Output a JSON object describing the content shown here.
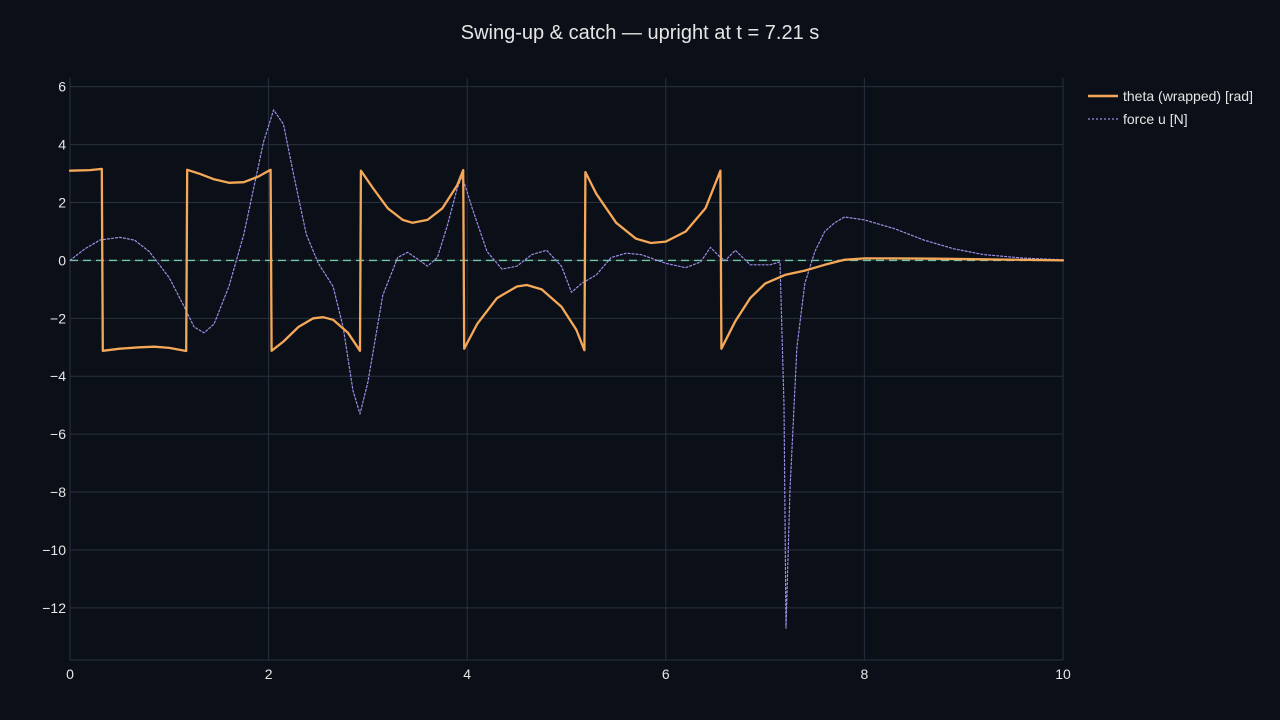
{
  "colors": {
    "background": "#0b0f17",
    "grid": "#283040",
    "text": "#e6e6e6",
    "theta": "#f5a858",
    "force": "#9b8fe6",
    "zero_line": "#6fc7a6"
  },
  "chart_data": {
    "type": "line",
    "title": "Swing-up & catch — upright at t = 7.21 s",
    "xlabel": "",
    "ylabel": "",
    "xlim": [
      0,
      10
    ],
    "ylim": [
      -13.8,
      6.3
    ],
    "x_ticks": [
      0,
      2,
      4,
      6,
      8,
      10
    ],
    "y_ticks": [
      6,
      4,
      2,
      0,
      -2,
      -4,
      -6,
      -8,
      -10,
      -12
    ],
    "grid": true,
    "legend_position": "top-right",
    "reference_line": {
      "y": 0,
      "style": "dashed"
    },
    "series": [
      {
        "name": "theta (wrapped) [rad]",
        "style": "solid",
        "points": [
          [
            0.0,
            3.1
          ],
          [
            0.2,
            3.12
          ],
          [
            0.32,
            3.16
          ],
          [
            0.33,
            -3.12
          ],
          [
            0.5,
            -3.05
          ],
          [
            0.7,
            -3.0
          ],
          [
            0.85,
            -2.98
          ],
          [
            1.0,
            -3.02
          ],
          [
            1.17,
            -3.13
          ],
          [
            1.18,
            3.13
          ],
          [
            1.3,
            3.0
          ],
          [
            1.45,
            2.8
          ],
          [
            1.6,
            2.68
          ],
          [
            1.75,
            2.7
          ],
          [
            1.9,
            2.9
          ],
          [
            2.02,
            3.13
          ],
          [
            2.03,
            -3.12
          ],
          [
            2.15,
            -2.8
          ],
          [
            2.3,
            -2.3
          ],
          [
            2.45,
            -2.0
          ],
          [
            2.55,
            -1.96
          ],
          [
            2.65,
            -2.05
          ],
          [
            2.8,
            -2.5
          ],
          [
            2.92,
            -3.12
          ],
          [
            2.93,
            3.1
          ],
          [
            3.05,
            2.5
          ],
          [
            3.2,
            1.8
          ],
          [
            3.35,
            1.4
          ],
          [
            3.45,
            1.3
          ],
          [
            3.6,
            1.4
          ],
          [
            3.75,
            1.8
          ],
          [
            3.9,
            2.6
          ],
          [
            3.96,
            3.12
          ],
          [
            3.97,
            -3.05
          ],
          [
            4.1,
            -2.2
          ],
          [
            4.3,
            -1.3
          ],
          [
            4.5,
            -0.9
          ],
          [
            4.6,
            -0.85
          ],
          [
            4.75,
            -1.0
          ],
          [
            4.95,
            -1.6
          ],
          [
            5.1,
            -2.4
          ],
          [
            5.18,
            -3.1
          ],
          [
            5.19,
            3.05
          ],
          [
            5.3,
            2.3
          ],
          [
            5.5,
            1.3
          ],
          [
            5.7,
            0.75
          ],
          [
            5.85,
            0.6
          ],
          [
            6.0,
            0.65
          ],
          [
            6.2,
            1.0
          ],
          [
            6.4,
            1.8
          ],
          [
            6.55,
            3.1
          ],
          [
            6.56,
            -3.05
          ],
          [
            6.7,
            -2.1
          ],
          [
            6.85,
            -1.3
          ],
          [
            7.0,
            -0.8
          ],
          [
            7.2,
            -0.5
          ],
          [
            7.4,
            -0.35
          ],
          [
            7.6,
            -0.15
          ],
          [
            7.8,
            0.02
          ],
          [
            8.0,
            0.07
          ],
          [
            8.3,
            0.07
          ],
          [
            8.7,
            0.06
          ],
          [
            9.2,
            0.04
          ],
          [
            10.0,
            0.0
          ]
        ]
      },
      {
        "name": "force u [N]",
        "style": "dotted",
        "points": [
          [
            0.0,
            0.0
          ],
          [
            0.15,
            0.4
          ],
          [
            0.3,
            0.7
          ],
          [
            0.5,
            0.8
          ],
          [
            0.65,
            0.7
          ],
          [
            0.8,
            0.3
          ],
          [
            1.0,
            -0.6
          ],
          [
            1.15,
            -1.6
          ],
          [
            1.25,
            -2.3
          ],
          [
            1.35,
            -2.5
          ],
          [
            1.45,
            -2.2
          ],
          [
            1.6,
            -0.9
          ],
          [
            1.75,
            0.9
          ],
          [
            1.85,
            2.5
          ],
          [
            1.95,
            4.1
          ],
          [
            2.05,
            5.2
          ],
          [
            2.15,
            4.7
          ],
          [
            2.25,
            3.0
          ],
          [
            2.38,
            0.9
          ],
          [
            2.5,
            -0.1
          ],
          [
            2.65,
            -0.9
          ],
          [
            2.75,
            -2.3
          ],
          [
            2.85,
            -4.5
          ],
          [
            2.92,
            -5.3
          ],
          [
            3.0,
            -4.2
          ],
          [
            3.15,
            -1.2
          ],
          [
            3.3,
            0.1
          ],
          [
            3.4,
            0.28
          ],
          [
            3.5,
            0.05
          ],
          [
            3.6,
            -0.2
          ],
          [
            3.7,
            0.1
          ],
          [
            3.8,
            1.2
          ],
          [
            3.9,
            2.5
          ],
          [
            3.95,
            2.9
          ],
          [
            4.05,
            1.8
          ],
          [
            4.2,
            0.3
          ],
          [
            4.35,
            -0.3
          ],
          [
            4.5,
            -0.2
          ],
          [
            4.65,
            0.2
          ],
          [
            4.8,
            0.35
          ],
          [
            4.95,
            -0.2
          ],
          [
            5.05,
            -1.1
          ],
          [
            5.15,
            -0.8
          ],
          [
            5.3,
            -0.5
          ],
          [
            5.45,
            0.1
          ],
          [
            5.6,
            0.25
          ],
          [
            5.75,
            0.2
          ],
          [
            6.0,
            -0.1
          ],
          [
            6.2,
            -0.25
          ],
          [
            6.35,
            -0.05
          ],
          [
            6.45,
            0.45
          ],
          [
            6.55,
            0.1
          ],
          [
            6.6,
            0.0
          ],
          [
            6.7,
            0.35
          ],
          [
            6.85,
            -0.15
          ],
          [
            7.05,
            -0.15
          ],
          [
            7.15,
            -0.05
          ],
          [
            7.19,
            -5.0
          ],
          [
            7.21,
            -12.7
          ],
          [
            7.25,
            -8.0
          ],
          [
            7.32,
            -3.0
          ],
          [
            7.4,
            -0.8
          ],
          [
            7.5,
            0.3
          ],
          [
            7.6,
            1.0
          ],
          [
            7.7,
            1.3
          ],
          [
            7.8,
            1.5
          ],
          [
            8.0,
            1.4
          ],
          [
            8.3,
            1.1
          ],
          [
            8.6,
            0.7
          ],
          [
            8.9,
            0.4
          ],
          [
            9.2,
            0.2
          ],
          [
            9.6,
            0.08
          ],
          [
            10.0,
            0.02
          ]
        ]
      }
    ]
  }
}
